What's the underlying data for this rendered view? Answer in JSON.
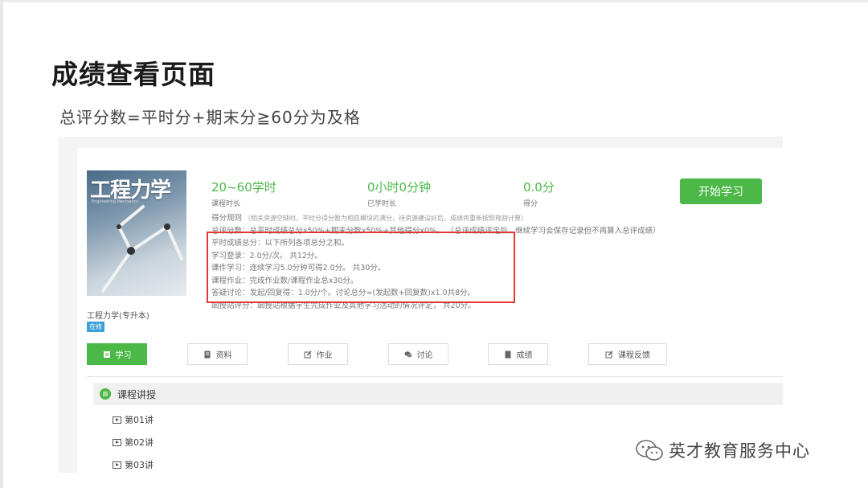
{
  "slide": {
    "title": "成绩查看页面",
    "subtitle": "总评分数=平时分+期末分≧60分为及格"
  },
  "course": {
    "cover_title": "工程力学",
    "cover_subtitle": "Engineering Mechanics",
    "name": "工程力学(专升本)",
    "status": "在修"
  },
  "stats": [
    {
      "value": "20~60学时",
      "label": "课程时长"
    },
    {
      "value": "0小时0分钟",
      "label": "已学时长"
    },
    {
      "value": "0.0分",
      "label": "得分"
    }
  ],
  "start_button": "开始学习",
  "rules": {
    "header": "得分规则",
    "header_note": "（相关资源空缺时，平时分得分暂为相应模块的满分，待资源建设好后，成绩将重新按照规则计算）",
    "total": "总评分数：总平时成绩总分x50%+期末分数x50%+其他得分x0%。",
    "total_note": "（总评成绩评定后，继续学习会保存记录但不再算入总评成绩）",
    "regular": "平时成绩总分：以下所列各项总分之和。",
    "items": [
      "学习登录：2.0分/次。 共12分。",
      "课件学习：连续学习5.0分钟可得2.0分。 共30分。",
      "课程作业：完成作业数/课程作业总x30分。",
      "答疑讨论：发起/回复得：1.0分/个。讨论总分=(发起数+回复数)x1.0共8分。",
      "函授站评分：函授站根据学生完成作业及其他学习活动的情况评定， 共20分。"
    ]
  },
  "tabs": [
    {
      "label": "学习",
      "icon": "book-icon"
    },
    {
      "label": "资料",
      "icon": "document-icon"
    },
    {
      "label": "作业",
      "icon": "edit-icon"
    },
    {
      "label": "讨论",
      "icon": "chat-icon"
    },
    {
      "label": "成绩",
      "icon": "list-icon"
    },
    {
      "label": "课程反馈",
      "icon": "edit-icon"
    }
  ],
  "section": {
    "title": "课程讲授",
    "lectures": [
      "第01讲",
      "第02讲",
      "第03讲"
    ]
  },
  "watermark": "英才教育服务中心",
  "colors": {
    "accent": "#4cb848",
    "highlight": "#e03838",
    "badge": "#3aa0d8"
  }
}
